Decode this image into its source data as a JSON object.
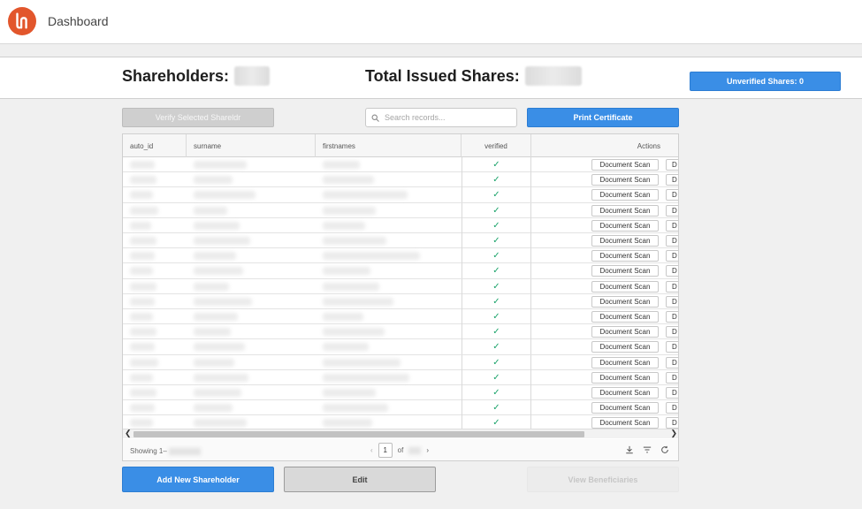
{
  "header": {
    "title": "Dashboard",
    "logo_icon": "lh-logo",
    "accent": "#e2562c"
  },
  "stats": {
    "shareholders_label": "Shareholders:",
    "total_issued_label": "Total Issued Shares:",
    "unverified_label": "Unverified Shares: 0"
  },
  "toolbar": {
    "verify_label": "Verify Selected Shareldr",
    "search_placeholder": "Search records...",
    "print_label": "Print Certificate"
  },
  "table": {
    "columns": [
      "auto_id",
      "surname",
      "firstnames",
      "verified",
      "Actions"
    ],
    "row_count": 18,
    "verified_mark": "✓",
    "doc_label": "Document Scan",
    "second_action_label": "D"
  },
  "footer": {
    "showing_label": "Showing 1–",
    "page": "1",
    "of_label": "of"
  },
  "actions": {
    "add_label": "Add New Shareholder",
    "edit_label": "Edit",
    "view_label": "View Beneficiaries"
  },
  "colors": {
    "primary": "#3a8ee6",
    "verified": "#1aa36a",
    "disabled": "#cfcfcf"
  }
}
